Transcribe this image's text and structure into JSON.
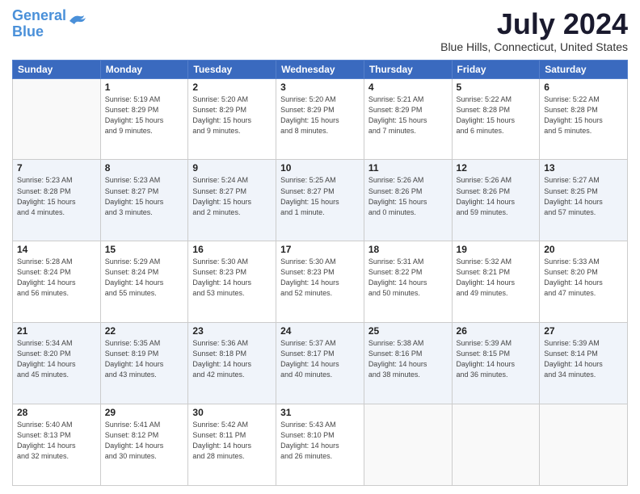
{
  "header": {
    "logo_line1": "General",
    "logo_line2": "Blue",
    "month": "July 2024",
    "location": "Blue Hills, Connecticut, United States"
  },
  "days_of_week": [
    "Sunday",
    "Monday",
    "Tuesday",
    "Wednesday",
    "Thursday",
    "Friday",
    "Saturday"
  ],
  "weeks": [
    [
      {
        "day": "",
        "info": ""
      },
      {
        "day": "1",
        "info": "Sunrise: 5:19 AM\nSunset: 8:29 PM\nDaylight: 15 hours\nand 9 minutes."
      },
      {
        "day": "2",
        "info": "Sunrise: 5:20 AM\nSunset: 8:29 PM\nDaylight: 15 hours\nand 9 minutes."
      },
      {
        "day": "3",
        "info": "Sunrise: 5:20 AM\nSunset: 8:29 PM\nDaylight: 15 hours\nand 8 minutes."
      },
      {
        "day": "4",
        "info": "Sunrise: 5:21 AM\nSunset: 8:29 PM\nDaylight: 15 hours\nand 7 minutes."
      },
      {
        "day": "5",
        "info": "Sunrise: 5:22 AM\nSunset: 8:28 PM\nDaylight: 15 hours\nand 6 minutes."
      },
      {
        "day": "6",
        "info": "Sunrise: 5:22 AM\nSunset: 8:28 PM\nDaylight: 15 hours\nand 5 minutes."
      }
    ],
    [
      {
        "day": "7",
        "info": "Sunrise: 5:23 AM\nSunset: 8:28 PM\nDaylight: 15 hours\nand 4 minutes."
      },
      {
        "day": "8",
        "info": "Sunrise: 5:23 AM\nSunset: 8:27 PM\nDaylight: 15 hours\nand 3 minutes."
      },
      {
        "day": "9",
        "info": "Sunrise: 5:24 AM\nSunset: 8:27 PM\nDaylight: 15 hours\nand 2 minutes."
      },
      {
        "day": "10",
        "info": "Sunrise: 5:25 AM\nSunset: 8:27 PM\nDaylight: 15 hours\nand 1 minute."
      },
      {
        "day": "11",
        "info": "Sunrise: 5:26 AM\nSunset: 8:26 PM\nDaylight: 15 hours\nand 0 minutes."
      },
      {
        "day": "12",
        "info": "Sunrise: 5:26 AM\nSunset: 8:26 PM\nDaylight: 14 hours\nand 59 minutes."
      },
      {
        "day": "13",
        "info": "Sunrise: 5:27 AM\nSunset: 8:25 PM\nDaylight: 14 hours\nand 57 minutes."
      }
    ],
    [
      {
        "day": "14",
        "info": "Sunrise: 5:28 AM\nSunset: 8:24 PM\nDaylight: 14 hours\nand 56 minutes."
      },
      {
        "day": "15",
        "info": "Sunrise: 5:29 AM\nSunset: 8:24 PM\nDaylight: 14 hours\nand 55 minutes."
      },
      {
        "day": "16",
        "info": "Sunrise: 5:30 AM\nSunset: 8:23 PM\nDaylight: 14 hours\nand 53 minutes."
      },
      {
        "day": "17",
        "info": "Sunrise: 5:30 AM\nSunset: 8:23 PM\nDaylight: 14 hours\nand 52 minutes."
      },
      {
        "day": "18",
        "info": "Sunrise: 5:31 AM\nSunset: 8:22 PM\nDaylight: 14 hours\nand 50 minutes."
      },
      {
        "day": "19",
        "info": "Sunrise: 5:32 AM\nSunset: 8:21 PM\nDaylight: 14 hours\nand 49 minutes."
      },
      {
        "day": "20",
        "info": "Sunrise: 5:33 AM\nSunset: 8:20 PM\nDaylight: 14 hours\nand 47 minutes."
      }
    ],
    [
      {
        "day": "21",
        "info": "Sunrise: 5:34 AM\nSunset: 8:20 PM\nDaylight: 14 hours\nand 45 minutes."
      },
      {
        "day": "22",
        "info": "Sunrise: 5:35 AM\nSunset: 8:19 PM\nDaylight: 14 hours\nand 43 minutes."
      },
      {
        "day": "23",
        "info": "Sunrise: 5:36 AM\nSunset: 8:18 PM\nDaylight: 14 hours\nand 42 minutes."
      },
      {
        "day": "24",
        "info": "Sunrise: 5:37 AM\nSunset: 8:17 PM\nDaylight: 14 hours\nand 40 minutes."
      },
      {
        "day": "25",
        "info": "Sunrise: 5:38 AM\nSunset: 8:16 PM\nDaylight: 14 hours\nand 38 minutes."
      },
      {
        "day": "26",
        "info": "Sunrise: 5:39 AM\nSunset: 8:15 PM\nDaylight: 14 hours\nand 36 minutes."
      },
      {
        "day": "27",
        "info": "Sunrise: 5:39 AM\nSunset: 8:14 PM\nDaylight: 14 hours\nand 34 minutes."
      }
    ],
    [
      {
        "day": "28",
        "info": "Sunrise: 5:40 AM\nSunset: 8:13 PM\nDaylight: 14 hours\nand 32 minutes."
      },
      {
        "day": "29",
        "info": "Sunrise: 5:41 AM\nSunset: 8:12 PM\nDaylight: 14 hours\nand 30 minutes."
      },
      {
        "day": "30",
        "info": "Sunrise: 5:42 AM\nSunset: 8:11 PM\nDaylight: 14 hours\nand 28 minutes."
      },
      {
        "day": "31",
        "info": "Sunrise: 5:43 AM\nSunset: 8:10 PM\nDaylight: 14 hours\nand 26 minutes."
      },
      {
        "day": "",
        "info": ""
      },
      {
        "day": "",
        "info": ""
      },
      {
        "day": "",
        "info": ""
      }
    ]
  ]
}
